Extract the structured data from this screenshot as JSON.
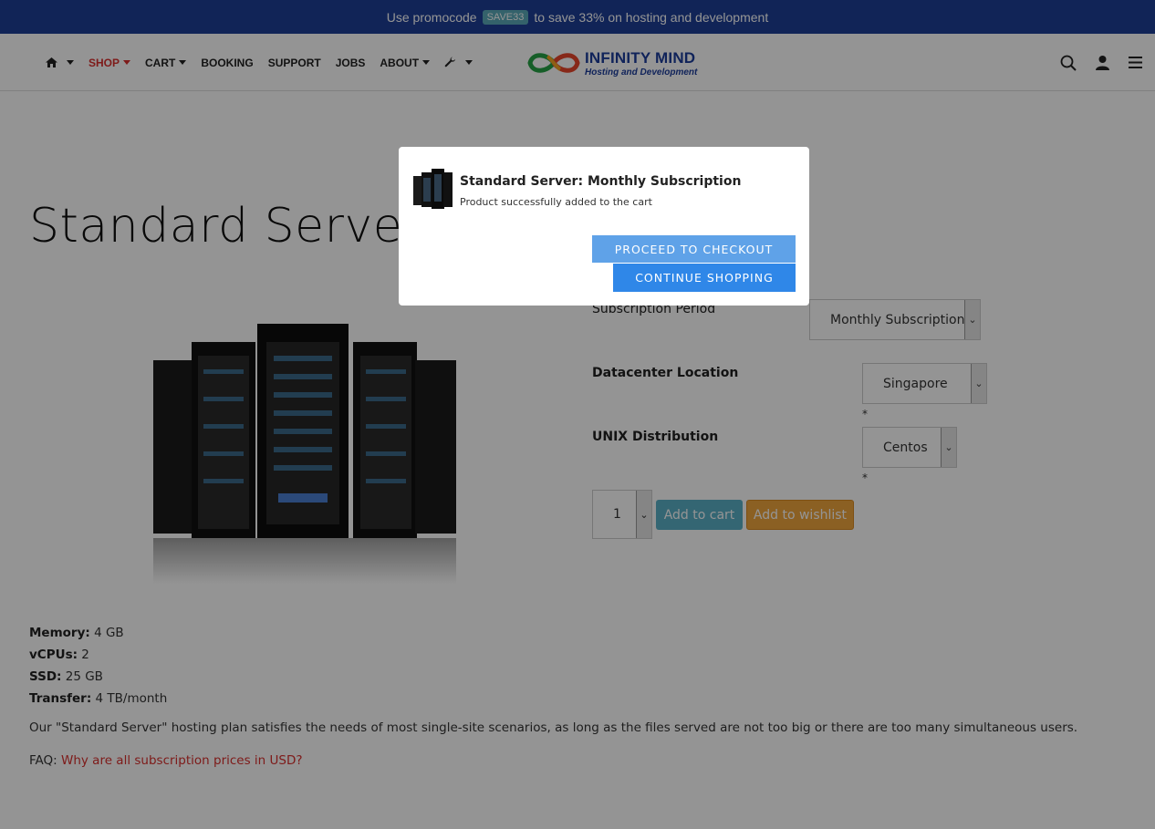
{
  "promo": {
    "prefix": "Use promocode",
    "code": "SAVE33",
    "suffix": "to save 33% on hosting and development"
  },
  "nav": {
    "items": [
      {
        "label": "",
        "icon": "home-icon"
      },
      {
        "label": "SHOP"
      },
      {
        "label": "CART"
      },
      {
        "label": "BOOKING"
      },
      {
        "label": "SUPPORT"
      },
      {
        "label": "JOBS"
      },
      {
        "label": "ABOUT"
      },
      {
        "label": "",
        "icon": "wrench-icon"
      }
    ],
    "active_color": "#d9302e"
  },
  "logo": {
    "line1": "INFINITY MIND",
    "line2": "Hosting and Development"
  },
  "header_icons": [
    "search-icon",
    "user-icon",
    "menu-icon"
  ],
  "product": {
    "title": "Standard Server",
    "options": {
      "subscription": {
        "label": "Subscription Period",
        "value": "Monthly Subscription"
      },
      "datacenter": {
        "label": "Datacenter Location",
        "value": "Singapore"
      },
      "distribution": {
        "label": "UNIX Distribution",
        "value": "Centos"
      },
      "required_mark": "*"
    },
    "quantity": "1",
    "add_to_cart": "Add to cart",
    "add_to_wishlist": "Add to wishlist",
    "specs": [
      {
        "label": "Memory:",
        "value": "4 GB"
      },
      {
        "label": "vCPUs:",
        "value": "2"
      },
      {
        "label": "SSD:",
        "value": "25 GB"
      },
      {
        "label": "Transfer:",
        "value": "4 TB/month"
      }
    ],
    "description": "Our \"Standard Server\" hosting plan satisfies the needs of most single-site scenarios, as long as the files served are not too big or there are too many simultaneous users.",
    "faq_prefix": "FAQ:",
    "faq_link": "Why are all subscription prices in USD?"
  },
  "modal": {
    "title": "Standard Server: Monthly Subscription",
    "subtitle": "Product successfully added to the cart",
    "checkout_label": "PROCEED TO CHECKOUT",
    "continue_label": "CONTINUE SHOPPING"
  },
  "colors": {
    "promo_bg": "#1e3f97",
    "accent_red": "#d9302e",
    "cart_btn": "#5ab0c6",
    "wishlist_btn": "#f0a63d",
    "checkout_btn": "#5fa2e8",
    "continue_btn": "#2f87e8"
  }
}
